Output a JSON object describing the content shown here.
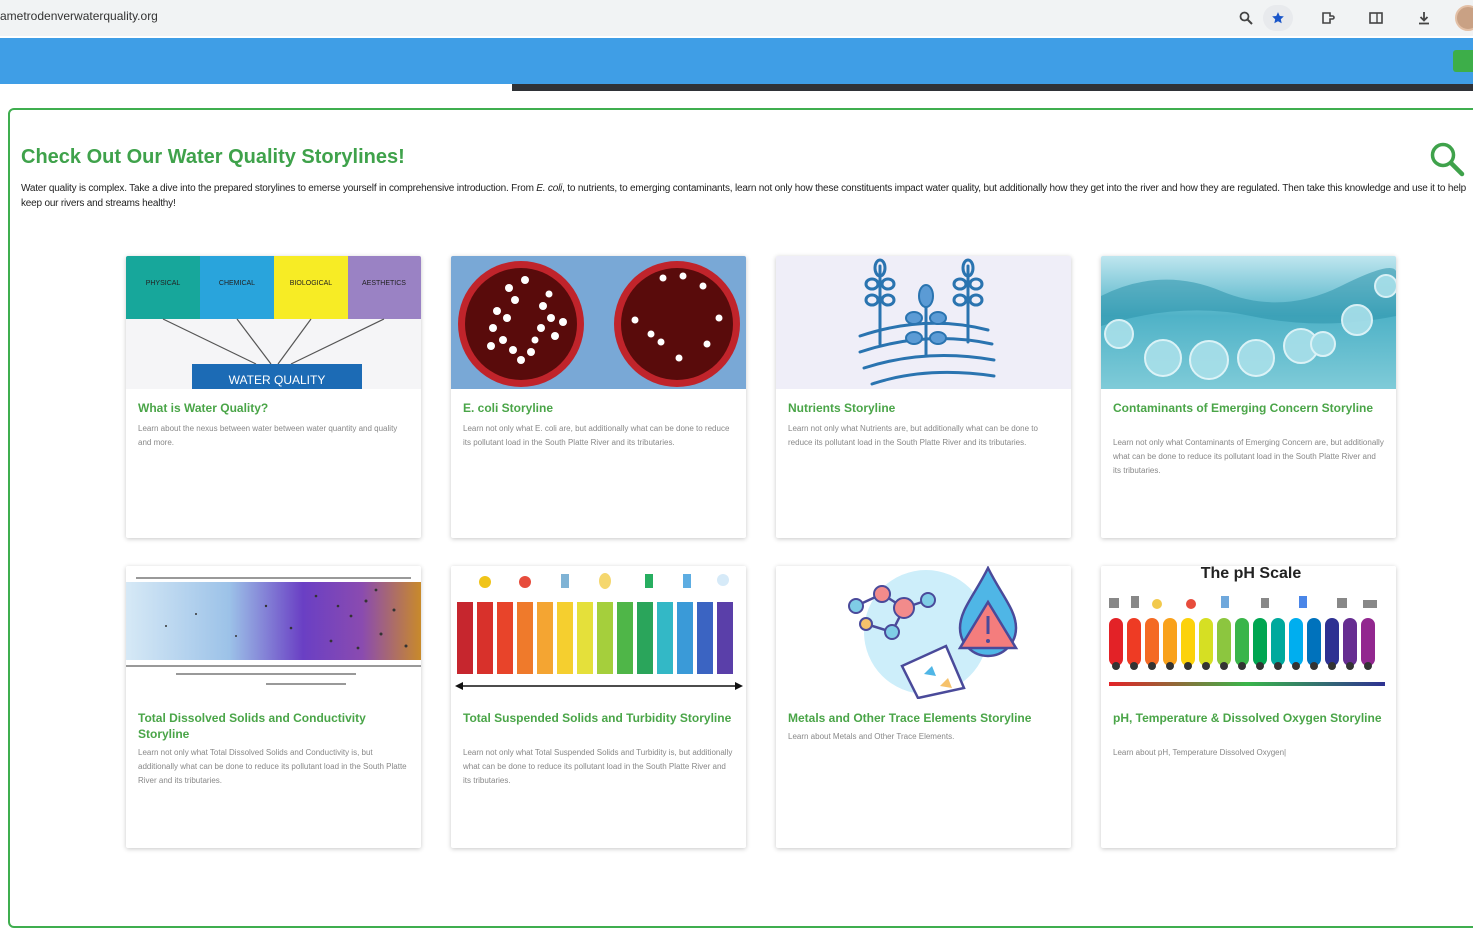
{
  "browser": {
    "url": "ametrodenverwaterquality.org"
  },
  "section": {
    "title": "Check Out Our Water Quality Storylines!",
    "intro_before": "Water quality is complex. Take a dive into the prepared storylines to emerse yourself in comprehensive introduction. From ",
    "intro_em": "E. coli",
    "intro_after": ", to nutrients, to emerging contaminants, learn not only how these constituents impact water quality, but additionally how they get into the river and how they are regulated. Then take this knowledge and use it to help keep our rivers and streams healthy!"
  },
  "cards": [
    {
      "title": "What is Water Quality?",
      "description": "Learn about the nexus between water between water quantity and quality and more.",
      "image_labels": {
        "c1": "PHYSICAL",
        "c2": "CHEMICAL",
        "c3": "BIOLOGICAL",
        "c4": "AESTHETICS",
        "banner": "WATER QUALITY"
      }
    },
    {
      "title": "E. coli Storyline",
      "description": "Learn not only what E. coli are, but additionally what can be done to reduce its pollutant load in the South Platte River and its tributaries."
    },
    {
      "title": "Nutrients Storyline",
      "description": "Learn not only what Nutrients are, but additionally what can be done to reduce its pollutant load in the South Platte River and its tributaries."
    },
    {
      "title": "Contaminants of Emerging Concern Storyline",
      "description": "Learn not only what Contaminants of Emerging Concern are, but additionally what can be done to reduce its pollutant load in the South Platte River and its tributaries."
    },
    {
      "title": "Total Dissolved Solids and Conductivity Storyline",
      "description": "Learn not only what Total Dissolved Solids and Conductivity is, but additionally what can be done to reduce its pollutant load in the South Platte River and its tributaries."
    },
    {
      "title": "Total Suspended Solids and Turbidity Storyline",
      "description": "Learn not only what Total Suspended Solids and Turbidity is, but additionally what can be done to reduce its pollutant load in the South Platte River and its tributaries."
    },
    {
      "title": "Metals and Other Trace Elements Storyline",
      "description": "Learn about Metals and Other Trace Elements."
    },
    {
      "title": "pH, Temperature & Dissolved Oxygen Storyline",
      "description": "Learn about pH, Temperature Dissolved Oxygen|",
      "image_labels": {
        "heading": "The pH Scale"
      }
    }
  ],
  "colors": {
    "brand_green": "#3fa24b",
    "nav_blue": "#3f9ee6",
    "card_title_green": "#4aa548"
  },
  "icons": [
    "zoom-icon",
    "bookmark-star-icon",
    "extensions-icon",
    "reading-mode-icon",
    "download-icon",
    "profile-avatar",
    "search-icon"
  ]
}
